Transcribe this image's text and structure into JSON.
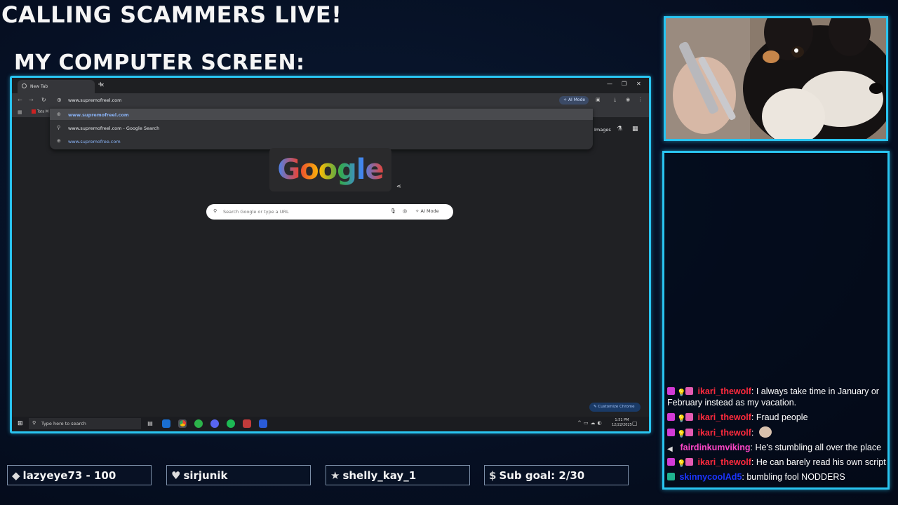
{
  "overlay": {
    "title": "CALLING SCAMMERS LIVE!",
    "screen_label": "MY COMPUTER SCREEN:"
  },
  "browser": {
    "tab_title": "New Tab",
    "address_text": "www.supremofreel.com",
    "ai_mode_label": "AI Mode",
    "bookmark_item": "Tata M",
    "dropdown": [
      {
        "text": "www.supremofreel.com",
        "icon": "globe-icon",
        "selected": true
      },
      {
        "text": "www.supremofreel.com - Google Search",
        "icon": "search-icon",
        "selected": false
      },
      {
        "text": "www.supremofree.com",
        "icon": "globe-icon",
        "selected": false
      }
    ],
    "images_label": "Images",
    "logo_text": "Google",
    "search_placeholder": "Search Google or type a URL",
    "search_ai_label": "AI Mode",
    "customize_label": "Customize Chrome"
  },
  "taskbar": {
    "search_text": "Type here to search",
    "time": "1:51 PM",
    "date": "12/22/2025"
  },
  "chat": [
    {
      "badges": [
        "heart",
        "bulb",
        "flower"
      ],
      "user": "ikari_thewolf",
      "user_color": "red",
      "text": "I always take time in January or February instead as my vacation."
    },
    {
      "badges": [
        "heart",
        "bulb",
        "flower"
      ],
      "user": "ikari_thewolf",
      "user_color": "red",
      "text": "Fraud people"
    },
    {
      "badges": [
        "heart",
        "bulb",
        "flower"
      ],
      "user": "ikari_thewolf",
      "user_color": "red",
      "text": ""
    },
    {
      "badges": [
        "mute"
      ],
      "user": "fairdinkumviking",
      "user_color": "pink",
      "text": "He's stumbling all over the place"
    },
    {
      "badges": [
        "heart",
        "bulb",
        "flower"
      ],
      "user": "ikari_thewolf",
      "user_color": "red",
      "text": "He can barely read his own script"
    },
    {
      "badges": [
        "green"
      ],
      "user": "skinnycoolAd5",
      "user_color": "blue",
      "text": "bumbling fool NODDERS"
    }
  ],
  "bottom_bar": [
    {
      "icon": "diamond-icon",
      "glyph": "◆",
      "text": "lazyeye73 - 100"
    },
    {
      "icon": "heart-icon",
      "glyph": "♥",
      "text": "sirjunik"
    },
    {
      "icon": "star-icon",
      "glyph": "★",
      "text": "shelly_kay_1"
    },
    {
      "icon": "dollar-icon",
      "glyph": "$",
      "text": "Sub goal: 2/30"
    }
  ],
  "colors": {
    "accent_frame": "#29c4f0",
    "user_red": "#ff2a3d",
    "user_pink": "#ff46c8",
    "user_blue": "#1c35ff"
  }
}
